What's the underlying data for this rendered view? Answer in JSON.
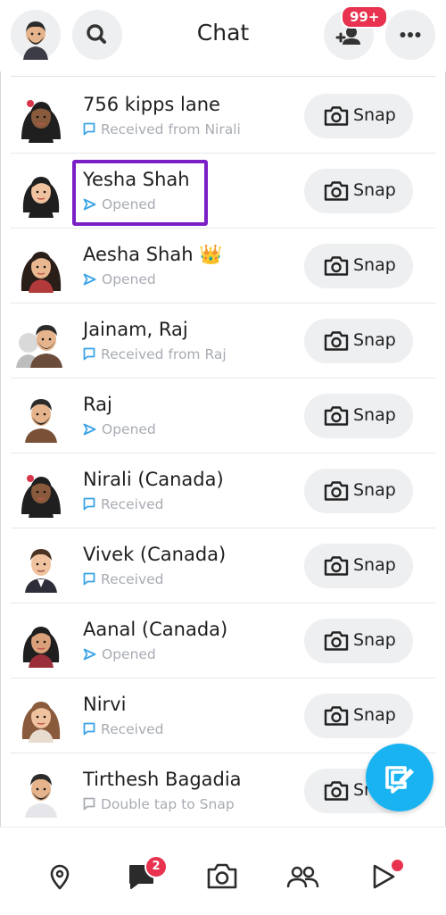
{
  "header": {
    "title": "Chat",
    "friend_requests_badge": "99+"
  },
  "chats": [
    {
      "name": "756 kipps lane",
      "status": "Received from Nirali",
      "status_type": "received"
    },
    {
      "name": "Yesha Shah",
      "status": "Opened",
      "status_type": "opened"
    },
    {
      "name": "Aesha Shah 👑",
      "status": "Opened",
      "status_type": "opened"
    },
    {
      "name": "Jainam, Raj",
      "status": "Received from Raj",
      "status_type": "received"
    },
    {
      "name": "Raj",
      "status": "Opened",
      "status_type": "opened"
    },
    {
      "name": "Nirali (Canada)",
      "status": "Received",
      "status_type": "received"
    },
    {
      "name": "Vivek (Canada)",
      "status": "Received",
      "status_type": "received"
    },
    {
      "name": "Aanal (Canada)",
      "status": "Opened",
      "status_type": "opened"
    },
    {
      "name": "Nirvi",
      "status": "Received",
      "status_type": "received"
    },
    {
      "name": "Tirthesh Bagadia",
      "status": "Double tap to Snap",
      "status_type": "tap"
    }
  ],
  "snap_label": "Snap",
  "bottom_nav": {
    "chat_badge": "2"
  },
  "colors": {
    "accent_blue": "#19b3f2",
    "badge_red": "#e8324f",
    "highlight_purple": "#7a1fc6",
    "status_blue": "#3aa3e6"
  }
}
